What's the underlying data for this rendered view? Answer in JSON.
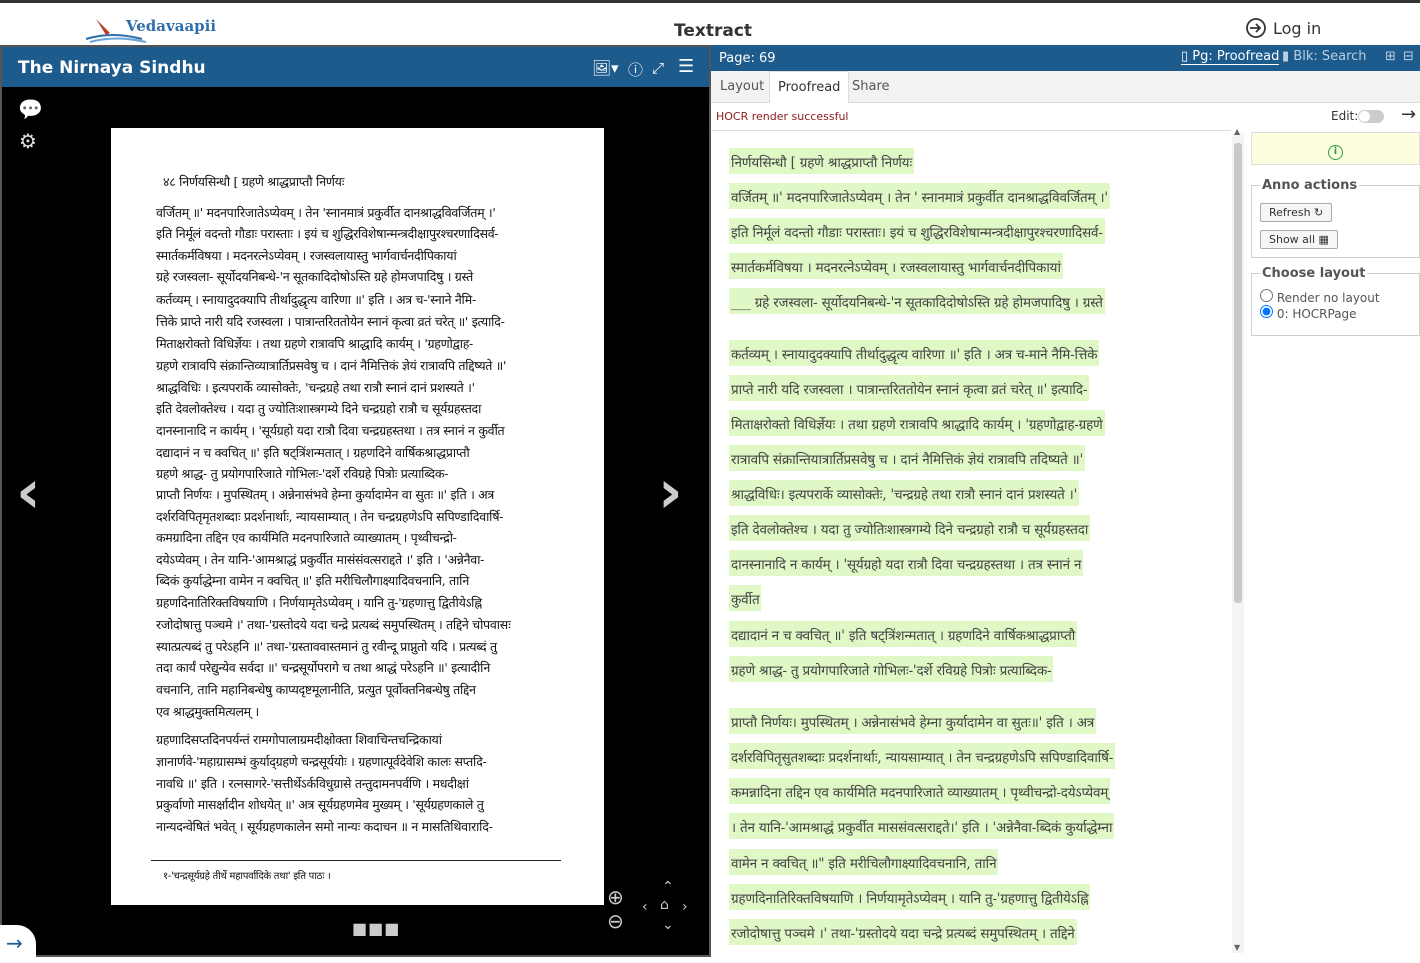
{
  "header": {
    "logo_text": "Vedavaapii",
    "app_title": "Textract",
    "login_label": "Log in"
  },
  "viewer": {
    "title": "The Nirnaya Sindhu",
    "book_lines": [
      "४८                       निर्णयसिन्धौ              [ ग्रहणे श्राद्धप्राप्तौ निर्णयः",
      "वर्जितम् ॥' मदनपारिजातेऽप्येवम् । तेन 'स्नानमात्रं प्रकुर्वीत दानश्राद्धविवर्जितम् ।'",
      "इति निर्मूलं वदन्तो गौडाः परास्ताः । इयं च शुद्धिरविशेषान्मन्त्रदीक्षापुरश्चरणादिसर्व-",
      "स्मार्तकर्मविषया । मदनरत्नेऽप्येवम् । रजस्वलायास्तु भार्गवार्चनदीपिकायां",
      "ग्रहे रजस्वला-  सूर्योदयनिबन्धे-'न सूतकादिदोषोऽस्ति ग्रहे होमजपादिषु । ग्रस्ते",
      "कर्तव्यम् ।  स्नायादुदक्यापि तीर्थादुद्धृत्य वारिणा ॥' इति । अत्र च-'स्नाने नैमि-",
      "त्तिके प्राप्ते नारी यदि रजस्वला । पात्रान्तरिततोयेन स्नानं कृत्वा व्रतं चरेत् ॥' इत्यादि-",
      "मिताक्षरोक्तो विधिर्ज्ञेयः । तथा ग्रहणे रात्रावपि श्राद्धादि कार्यम् । 'ग्रहणोद्वाह-",
      "ग्रहणे रात्रावपि संक्रान्तिव्यात्रार्तिप्रसवेषु च । दानं नैमित्तिकं ज्ञेयं रात्रावपि तद्दिष्यते ॥'",
      "श्राद्धविधिः ।  इत्यपरार्के व्यासोक्तेः, 'चन्द्रग्रहे तथा रात्रौ स्नानं दानं प्रशस्यते ।'",
      "इति देवलोक्तेश्च । यदा तु ज्योतिःशास्त्रगम्ये दिने चन्द्रग्रहो रात्रौ च सूर्यग्रहस्तदा",
      "दानस्नानादि न कार्यम् । 'सूर्यग्रहो यदा रात्रौ दिवा चन्द्रग्रहस्तथा । तत्र स्नानं न कुर्वीत",
      "दद्यादानं न च क्वचित् ॥' इति षट्त्रिंशन्मतात् । ग्रहणदिने वार्षिकश्राद्धप्राप्तौ",
      "ग्रहणे श्राद्ध-  तु प्रयोगपारिजाते गोभिलः-'दर्शे रविग्रहे पित्रोः प्रत्याब्दिक-",
      "प्राप्तौ निर्णयः ।  मुपस्थितम् । अन्नेनासंभवे हेम्ना कुर्यादामेन वा सुतः ॥' इति । अत्र",
      "दर्शरविपितृमृतशब्दाः प्रदर्शनार्थाः, न्यायसाम्यात् । तेन चन्द्रग्रहणेऽपि सपिण्डादिवार्षि-",
      "कमग्रादिना तद्दिन एव कार्यमिति मदनपारिजाते व्याख्यातम् । पृथ्वीचन्द्रो-",
      "दयेऽप्येवम् । तेन यानि-'आमश्राद्धं प्रकुर्वीत मासंसंवत्सराद्दते ।' इति । 'अन्नेनैवा-",
      "ब्दिकं कुर्याद्धेम्ना वामेन न क्वचित् ॥' इति मरीचिलौगाक्ष्यादिवचनानि, तानि",
      "ग्रहणदिनातिरिक्तविषयाणि । निर्णयामृतेऽप्येवम् । यानि तु-'ग्रहणात्तु द्वितीयेऽह्नि",
      "रजोदोषात्तु पञ्चमे ।' तथा-'ग्रस्तोदये यदा चन्द्रे प्रत्यब्दं समुपस्थितम् । तद्दिने चोपवासः",
      "स्यात्प्रत्यब्दं तु परेऽहनि ॥' तथा-'ग्रस्ताववास्तमानं तु रवीन्दू प्राप्नुतो यदि । प्रत्यब्दं तु",
      "तदा कार्यं परेद्युन्येव सर्वदा ॥' चन्द्रसूर्योपरागे च तथा श्राद्धं परेऽहनि ॥' इत्यादीनि",
      "वचनानि, तानि महानिबन्धेषु काप्यदृष्टमूलानीति, प्रत्युत पूर्वोक्तनिबन्धेषु तद्दिन",
      "एव श्राद्धमुक्तमित्यलम् ।",
      "ग्रहणादिसप्तदिनपर्यन्तं रामगोपालाग्रमदीक्षोक्ता शिवाचिन्तचन्द्रिकायां",
      "ज्ञानार्णवे-'महाग्रासम्भं कुर्याद्ग्रहणे चन्द्रसूर्ययोः । ग्रहणात्पूर्वदेवेशि कालः सप्तदि-",
      "नावधि ॥' इति । रत्नसागरे-'सत्तीर्थेऽर्कविधुग्रासे तन्तुदामनपर्वणि । मधदीक्षां",
      "प्रकुर्वाणो मासर्क्षादीन शोधयेत् ॥' अत्र सूर्यग्रहणमेव मुख्यम् । 'सूर्यग्रहणकाले तु",
      "नान्यदन्वेषितं भवेत् । सूर्यग्रहणकालेन समो नान्यः कदाचन ॥ न मासतिथिवारादि-",
      "१-'चन्द्रसूर्यग्रहे तीर्थे महापर्वादिके तथा' इति पाठः ।"
    ]
  },
  "proofread": {
    "page_label": "Page: 69",
    "pg_mode": "Pg: Proofread",
    "blk_mode": "Blk: Search",
    "tabs": [
      "Layout",
      "Proofread",
      "Share"
    ],
    "status": "HOCR render successful",
    "edit_label": "Edit:",
    "lines": [
      "निर्णयसिन्धौ [ ग्रहणे श्राद्धप्राप्तौ निर्णयः",
      "वर्जितम् ॥' मदनपारिजातेऽप्येवम् । तेन ' स्नानमात्रं प्रकुर्वीत दानश्राद्धविवर्जितम् ।'",
      "इति निर्मूलं वदन्तो गौडाः परास्ताः। इयं च शुद्धिरविशेषान्मन्त्रदीक्षापुरश्चरणादिसर्व-",
      "स्मार्तकर्मविषया । मदनरत्नेऽप्येवम् । रजस्वलायास्तु भार्गवार्चनदीपिकायां",
      "___  ग्रहे रजस्वला- सूर्योदयनिबन्धे-'न सूतकादिदोषोऽस्ति ग्रहे होमजपादिषु । ग्रस्ते",
      "कर्तव्यम् । स्नायादुदक्यापि तीर्थादुद्धृत्य वारिणा ॥' इति । अत्र च-माने नैमि-त्तिके",
      "प्राप्ते नारी यदि रजस्वला । पात्रान्तरिततोयेन स्नानं कृत्वा व्रतं चरेत् ॥' इत्यादि-",
      "मिताक्षरोक्तो विधिर्ज्ञेयः । तथा ग्रहणे रात्रावपि श्राद्धादि कार्यम् । 'ग्रहणोद्वाह-ग्रहणे",
      "रात्रावपि संक्रान्तियात्रार्तिप्रसवेषु च । दानं नैमित्तिकं ज्ञेयं रात्रावपि तदिष्यते ॥'",
      "श्राद्धविधिः। इत्यपरार्के व्यासोक्तेः, 'चन्द्रग्रहे तथा रात्रौ स्नानं दानं प्रशस्यते ।'",
      "इति देवलोक्तेश्च । यदा तु ज्योतिःशास्त्रगम्ये दिने चन्द्रग्रहो रात्रौ च सूर्यग्रहस्तदा",
      "दानस्नानादि न कार्यम् । 'सूर्यग्रहो यदा रात्रौ दिवा चन्द्रग्रहस्तथा । तत्र स्नानं न",
      "कुर्वीत",
      "दद्यादानं न च क्वचित् ॥' इति षट्त्रिंशन्मतात् । ग्रहणदिने वार्षिकश्राद्धप्राप्तौ",
      "ग्रहणे श्राद्ध- तु प्रयोगपारिजाते गोभिलः-'दर्शे रविग्रहे पित्रोः प्रत्याब्दिक-",
      "प्राप्तौ निर्णयः। मुपस्थितम् । अन्नेनासंभवे हेम्ना कुर्यादामेन वा सुतः॥' इति । अत्र",
      "दर्शरविपितृसुतशब्दाः प्रदर्शनार्थाः, न्यायसाम्यात् । तेन चन्द्रग्रहणेऽपि सपिण्डादिवार्षि-",
      "कमन्नादिना तद्दिन एव कार्यमिति मदनपारिजाते व्याख्यातम् । पृथ्वीचन्द्रो-दयेऽप्येवम्",
      "। तेन यानि-'आमश्राद्धं प्रकुर्वीत माससंवत्सराद्दते।' इति । 'अन्नेनैवा-ब्दिकं कुर्याद्धेम्ना",
      "वामेन न क्वचित् ॥\" इति मरीचिलौगाक्ष्यादिवचनानि, तानि",
      "ग्रहणदिनातिरिक्तविषयाणि । निर्णयामृतेऽप्येवम् । यानि तु-'ग्रहणात्तु द्वितीयेऽह्नि",
      "रजोदोषात्तु पञ्चमे ।' तथा-'ग्रस्तोदये यदा चन्द्रे प्रत्यब्दं समुपस्थितम् । तद्दिने"
    ],
    "sidebar": {
      "anno_legend": "Anno actions",
      "refresh_label": "Refresh",
      "show_all_label": "Show all",
      "layout_legend": "Choose layout",
      "opt_no_layout": "Render no layout",
      "opt_hocr": "0: HOCRPage"
    }
  }
}
